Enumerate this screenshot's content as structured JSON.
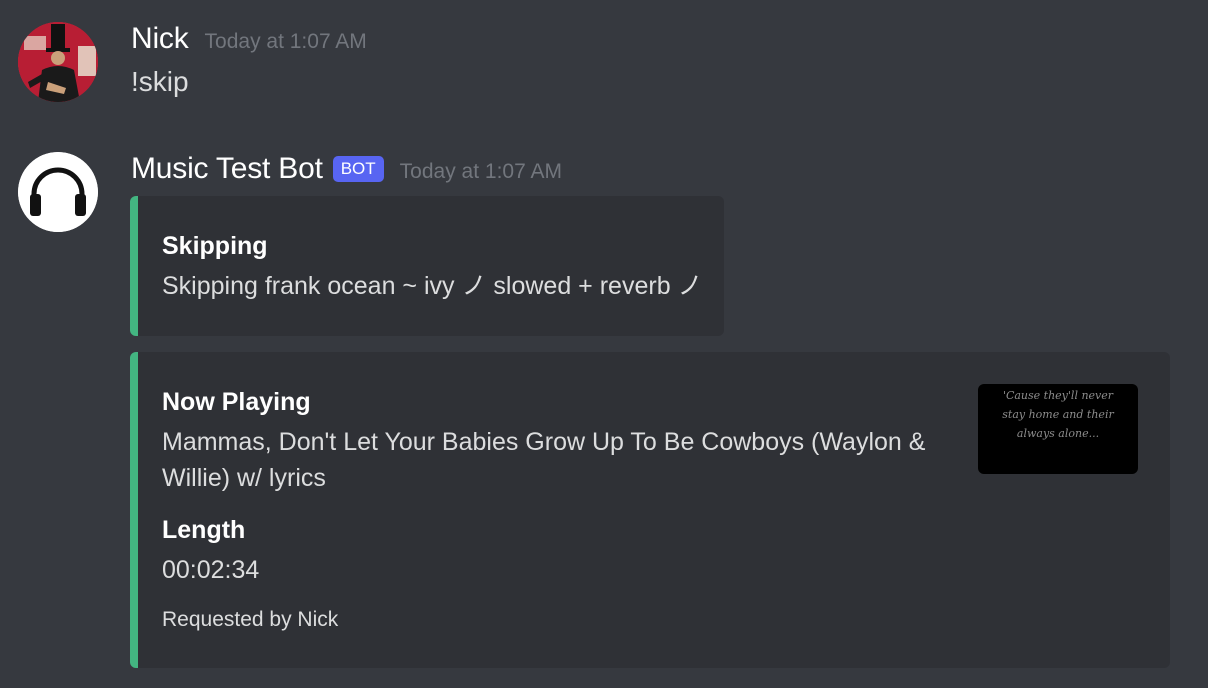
{
  "messages": [
    {
      "author": "Nick",
      "timestamp": "Today at 1:07 AM",
      "content": "!skip"
    },
    {
      "author": "Music Test Bot",
      "tag": "BOT",
      "timestamp": "Today at 1:07 AM",
      "embeds": [
        {
          "color": "#43b581",
          "fields": [
            {
              "name": "Skipping",
              "value": "Skipping frank ocean ~ ivy ノ slowed + reverb ノ"
            }
          ]
        },
        {
          "color": "#43b581",
          "fields": [
            {
              "name": "Now Playing",
              "value": "Mammas, Don't Let Your Babies Grow Up To Be Cowboys (Waylon & Willie) w/ lyrics"
            },
            {
              "name": "Length",
              "value": "00:02:34"
            }
          ],
          "footer": "Requested by Nick",
          "thumbnail_text": "'Cause they'll never stay home and their always alone..."
        }
      ]
    }
  ],
  "colors": {
    "background": "#36393f",
    "embed_background": "#2f3136",
    "embed_border": "#43b581",
    "bot_tag": "#5865f2",
    "timestamp": "#72767d"
  },
  "icons": {
    "user_avatar": "user-avatar-image",
    "bot_avatar": "headphones-icon"
  }
}
